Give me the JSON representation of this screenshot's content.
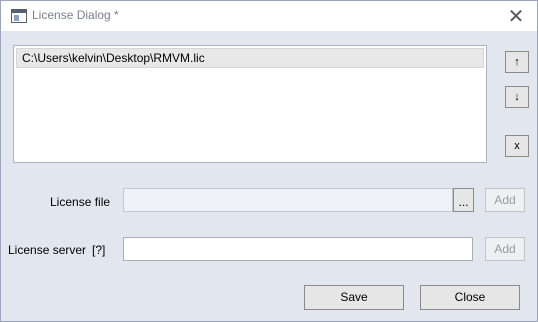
{
  "window": {
    "title": "License Dialog *"
  },
  "license_list": {
    "items": [
      "C:\\Users\\kelvin\\Desktop\\RMVM.lic"
    ]
  },
  "side_buttons": {
    "move_up": "↑",
    "move_down": "↓",
    "remove": "x"
  },
  "license_file": {
    "label": "License file",
    "value": "",
    "browse": "...",
    "add": "Add"
  },
  "license_server": {
    "label": "License server",
    "help": "[?]",
    "value": "",
    "add": "Add"
  },
  "footer": {
    "save": "Save",
    "close": "Close"
  },
  "icons": {
    "app": "app-window-icon",
    "close": "close-icon",
    "up": "arrow-up-icon",
    "down": "arrow-down-icon"
  }
}
